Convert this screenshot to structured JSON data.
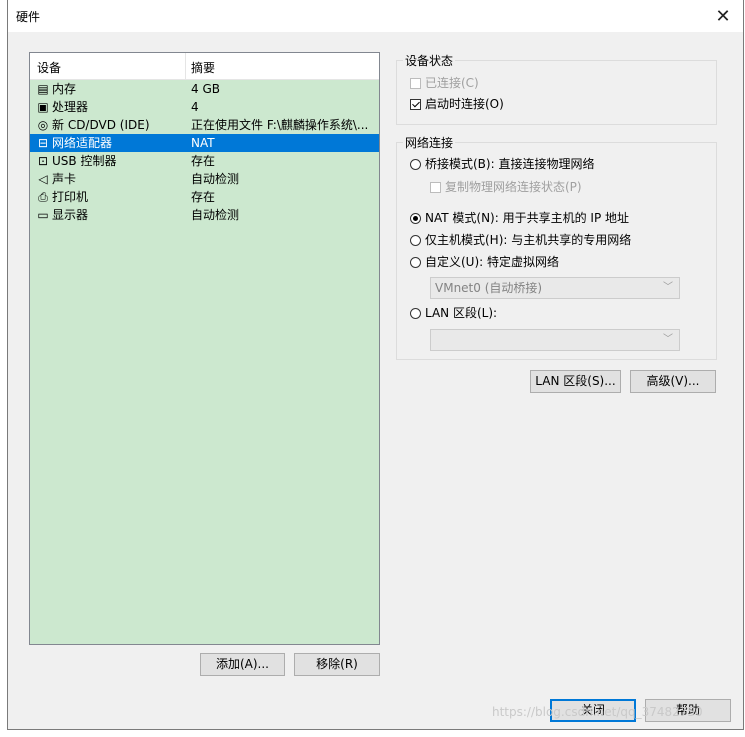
{
  "window": {
    "title": "硬件",
    "close_glyph": "✕"
  },
  "device_list": {
    "columns": [
      "设备",
      "摘要"
    ],
    "rows": [
      {
        "icon": "memory-icon",
        "glyph": "▤",
        "name": "内存",
        "summary": "4 GB"
      },
      {
        "icon": "processor-icon",
        "glyph": "▣",
        "name": "处理器",
        "summary": "4"
      },
      {
        "icon": "cd-dvd-icon",
        "glyph": "◎",
        "name": "新 CD/DVD (IDE)",
        "summary": "正在使用文件 F:\\麒麟操作系统\\..."
      },
      {
        "icon": "network-adapter-icon",
        "glyph": "⊟",
        "name": "网络适配器",
        "summary": "NAT",
        "selected": true
      },
      {
        "icon": "usb-controller-icon",
        "glyph": "⊡",
        "name": "USB 控制器",
        "summary": "存在"
      },
      {
        "icon": "sound-card-icon",
        "glyph": "◁",
        "name": "声卡",
        "summary": "自动检测"
      },
      {
        "icon": "printer-icon",
        "glyph": "⎙",
        "name": "打印机",
        "summary": "存在"
      },
      {
        "icon": "display-icon",
        "glyph": "▭",
        "name": "显示器",
        "summary": "自动检测"
      }
    ]
  },
  "buttons": {
    "add": "添加(A)...",
    "remove": "移除(R)",
    "lan_segments": "LAN 区段(S)...",
    "advanced": "高级(V)...",
    "close": "关闭",
    "help": "帮助"
  },
  "device_status": {
    "title": "设备状态",
    "connected": "已连接(C)",
    "connect_at_power_on": "启动时连接(O)"
  },
  "network_connection": {
    "title": "网络连接",
    "bridged": "桥接模式(B): 直接连接物理网络",
    "replicate_state": "复制物理网络连接状态(P)",
    "nat": "NAT 模式(N): 用于共享主机的 IP 地址",
    "host_only": "仅主机模式(H): 与主机共享的专用网络",
    "custom": "自定义(U): 特定虚拟网络",
    "custom_value": "VMnet0 (自动桥接)",
    "lan_segment": "LAN 区段(L):",
    "lan_segment_value": ""
  },
  "watermark": "https://blog.csdn.net/qq_37482750"
}
